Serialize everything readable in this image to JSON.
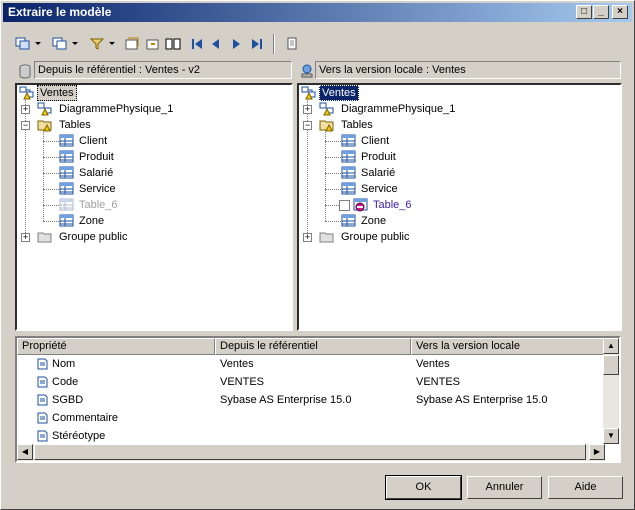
{
  "window": {
    "title": "Extraire le modèle"
  },
  "titlebar_buttons": {
    "minimize": "_",
    "maximize": "□",
    "close": "×"
  },
  "left_pane": {
    "header": "Depuis le référentiel : Ventes - v2",
    "root": "Ventes",
    "diagram": "DiagrammePhysique_1",
    "tables_folder": "Tables",
    "tables": [
      "Client",
      "Produit",
      "Salarié",
      "Service",
      "Table_6",
      "Zone"
    ],
    "group": "Groupe public"
  },
  "right_pane": {
    "header": "Vers la version locale : Ventes",
    "root": "Ventes",
    "diagram": "DiagrammePhysique_1",
    "tables_folder": "Tables",
    "tables": [
      "Client",
      "Produit",
      "Salarié",
      "Service",
      "Table_6",
      "Zone"
    ],
    "group": "Groupe public"
  },
  "grid": {
    "headers": [
      "Propriété",
      "Depuis le référentiel",
      "Vers la version locale"
    ],
    "rows": [
      [
        "Nom",
        "Ventes",
        "Ventes"
      ],
      [
        "Code",
        "VENTES",
        "VENTES"
      ],
      [
        "SGBD",
        "Sybase AS Enterprise 15.0",
        "Sybase AS Enterprise 15.0"
      ],
      [
        "Commentaire",
        "",
        ""
      ],
      [
        "Stéréotype",
        "",
        ""
      ]
    ]
  },
  "buttons": {
    "ok": "OK",
    "cancel": "Annuler",
    "help": "Aide"
  },
  "colors": {
    "title_start": "#0a246a",
    "title_end": "#a6caf0",
    "selection": "#0a246a",
    "deleted_item": "#6a1fb0",
    "greyed_item": "#a0a0a0"
  },
  "icons": [
    "model-icon",
    "folder-icon",
    "table-icon",
    "warning-icon",
    "repository-icon",
    "local-model-icon"
  ]
}
